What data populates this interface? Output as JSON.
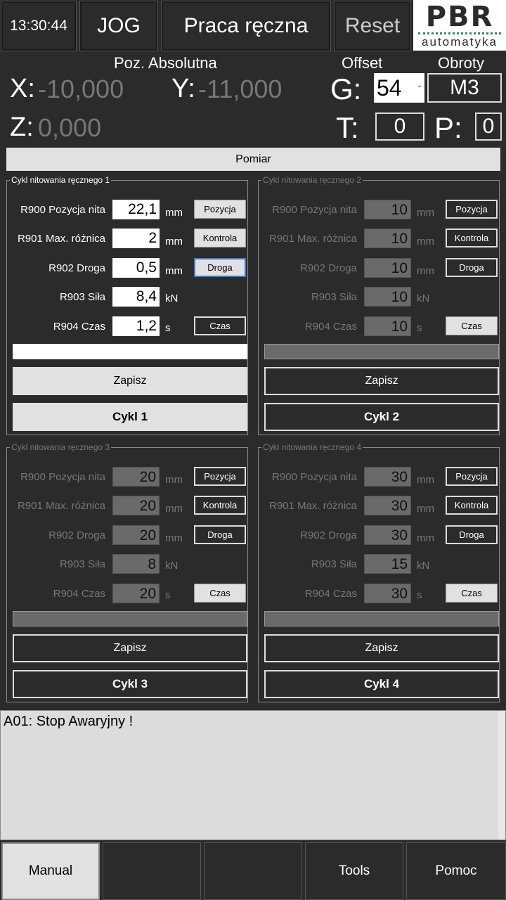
{
  "header": {
    "time": "13:30:44",
    "mode": "JOG",
    "screen_title": "Praca ręczna",
    "reset_label": "Reset",
    "logo_top": "PBR",
    "logo_bottom": "automatyka"
  },
  "position": {
    "abs_label": "Poz. Absolutna",
    "offset_label": "Offset",
    "rpm_label": "Obroty",
    "x_label": "X:",
    "x_value": "-10,000",
    "y_label": "Y:",
    "y_value": "-11,000",
    "z_label": "Z:",
    "z_value": "0,000",
    "g_label": "G:",
    "g_value": "54",
    "spindle": "M3",
    "t_label": "T:",
    "t_value": "0",
    "p_label": "P:",
    "p_value": "0"
  },
  "pomiar_label": "Pomiar",
  "panels": [
    {
      "title": "Cykl nitowania ręcznego 1",
      "rows": [
        {
          "label": "R900 Pozycja nita",
          "value": "22,1",
          "unit": "mm",
          "button": "Pozycja"
        },
        {
          "label": "R901 Max. różnica",
          "value": "2",
          "unit": "mm",
          "button": "Kontrola"
        },
        {
          "label": "R902 Droga",
          "value": "0,5",
          "unit": "mm",
          "button": "Droga"
        },
        {
          "label": "R903 Siła",
          "value": "8,4",
          "unit": "kN",
          "button": ""
        },
        {
          "label": "R904 Czas",
          "value": "1,2",
          "unit": "s",
          "button": "Czas"
        }
      ],
      "save": "Zapisz",
      "cycle": "Cykl 1"
    },
    {
      "title": "Cykl nitowania ręcznego 2",
      "rows": [
        {
          "label": "R900 Pozycja nita",
          "value": "10",
          "unit": "mm",
          "button": "Pozycja"
        },
        {
          "label": "R901 Max. różnica",
          "value": "10",
          "unit": "mm",
          "button": "Kontrola"
        },
        {
          "label": "R902 Droga",
          "value": "10",
          "unit": "mm",
          "button": "Droga"
        },
        {
          "label": "R903 Siła",
          "value": "10",
          "unit": "kN",
          "button": ""
        },
        {
          "label": "R904 Czas",
          "value": "10",
          "unit": "s",
          "button": "Czas"
        }
      ],
      "save": "Zapisz",
      "cycle": "Cykl 2"
    },
    {
      "title": "Cykl nitowania ręcznego 3",
      "rows": [
        {
          "label": "R900 Pozycja nita",
          "value": "20",
          "unit": "mm",
          "button": "Pozycja"
        },
        {
          "label": "R901 Max. różnica",
          "value": "20",
          "unit": "mm",
          "button": "Kontrola"
        },
        {
          "label": "R902 Droga",
          "value": "20",
          "unit": "mm",
          "button": "Droga"
        },
        {
          "label": "R903 Siła",
          "value": "8",
          "unit": "kN",
          "button": ""
        },
        {
          "label": "R904 Czas",
          "value": "20",
          "unit": "s",
          "button": "Czas"
        }
      ],
      "save": "Zapisz",
      "cycle": "Cykl 3"
    },
    {
      "title": "Cykl nitowania ręcznego 4",
      "rows": [
        {
          "label": "R900 Pozycja nita",
          "value": "30",
          "unit": "mm",
          "button": "Pozycja"
        },
        {
          "label": "R901 Max. różnica",
          "value": "30",
          "unit": "mm",
          "button": "Kontrola"
        },
        {
          "label": "R902 Droga",
          "value": "30",
          "unit": "mm",
          "button": "Droga"
        },
        {
          "label": "R903 Siła",
          "value": "15",
          "unit": "kN",
          "button": ""
        },
        {
          "label": "R904 Czas",
          "value": "30",
          "unit": "s",
          "button": "Czas"
        }
      ],
      "save": "Zapisz",
      "cycle": "Cykl 4"
    }
  ],
  "alarm_text": "A01: Stop Awaryjny !",
  "footer": {
    "manual": "Manual",
    "empty1": "",
    "empty2": "",
    "tools": "Tools",
    "help": "Pomoc"
  }
}
